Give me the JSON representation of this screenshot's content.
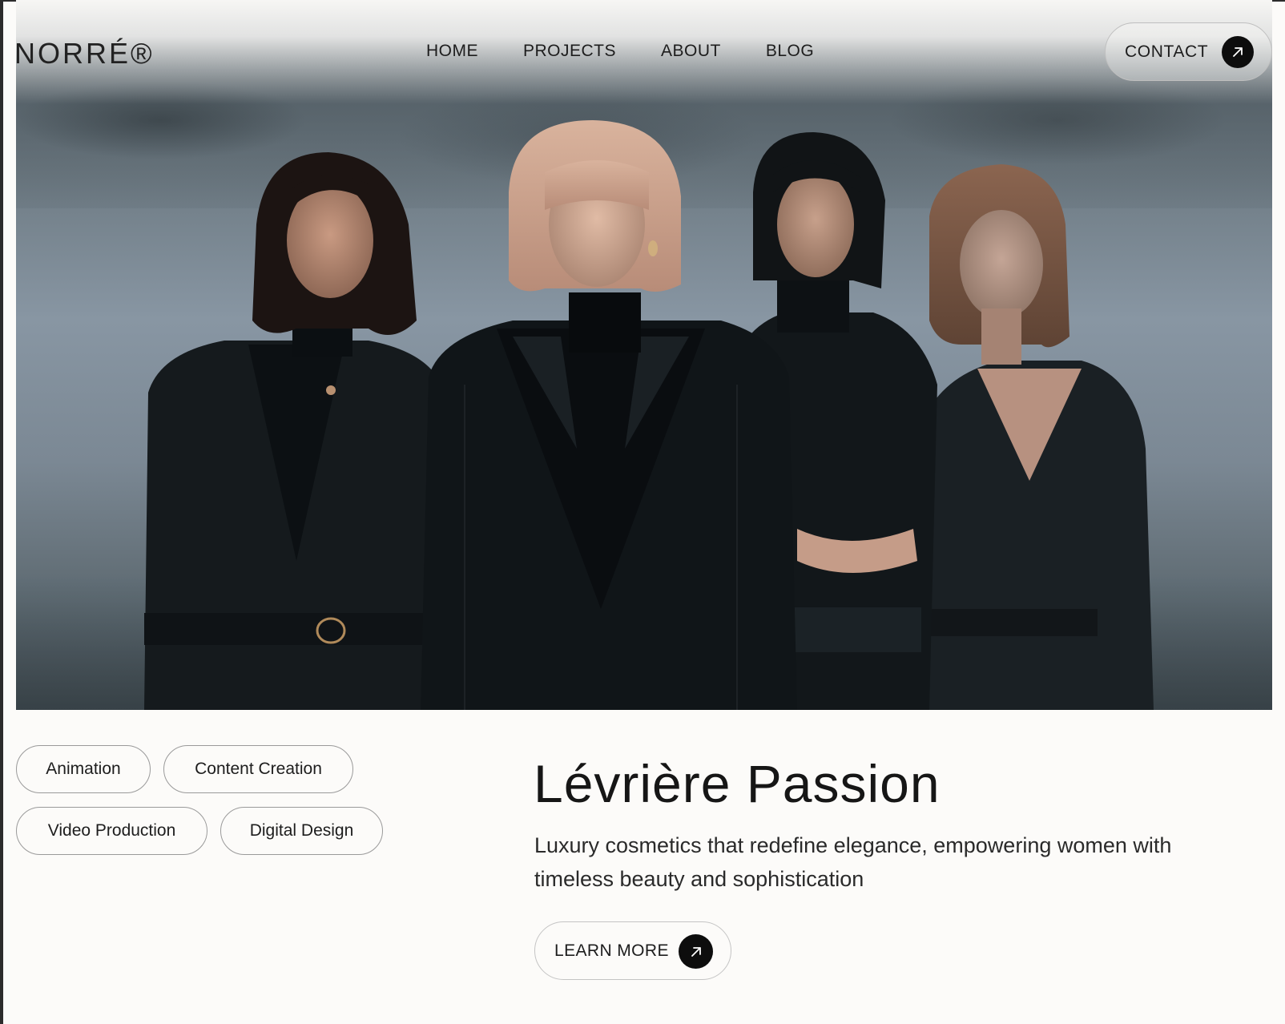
{
  "header": {
    "logo": "NORRÉ®",
    "nav": [
      "HOME",
      "PROJECTS",
      "ABOUT",
      "BLOG"
    ],
    "contact_label": "CONTACT",
    "contact_icon": "arrow-up-right-icon"
  },
  "hero": {
    "image": "four-women-in-black-outfits-photo"
  },
  "tags": [
    "Animation",
    "Content Creation",
    "Video Production",
    "Digital Design"
  ],
  "project": {
    "title": "Lévrière Passion",
    "description": "Luxury cosmetics that redefine elegance, empowering women with timeless beauty and sophistication",
    "cta_label": "LEARN MORE",
    "cta_icon": "arrow-up-right-icon"
  },
  "colors": {
    "background": "#fcfbf9",
    "accent_dark": "#0d0d0d",
    "border": "#9a9a9a"
  }
}
